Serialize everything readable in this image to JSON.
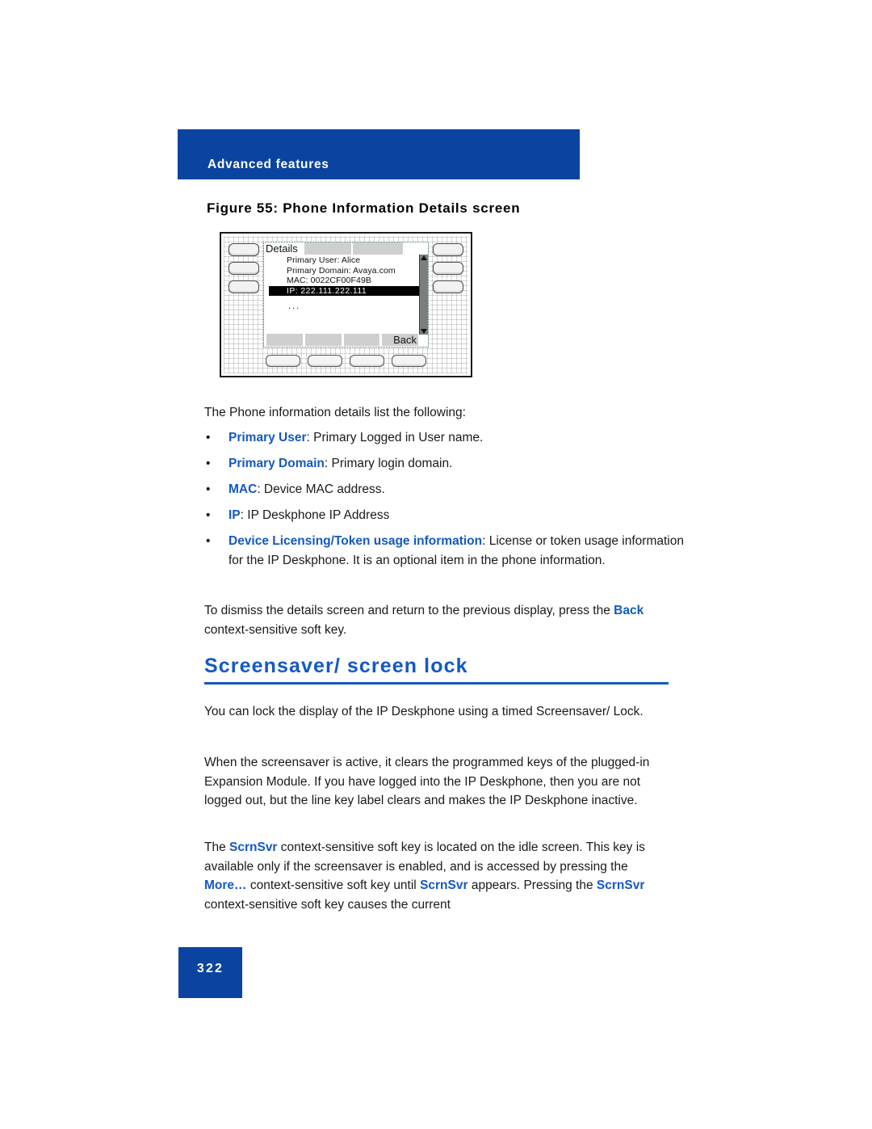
{
  "header": {
    "section_label": "Advanced features"
  },
  "figure": {
    "caption": "Figure 55: Phone Information Details screen",
    "device": {
      "screen_title": "Details",
      "lines": [
        "Primary User: Alice",
        "Primary Domain: Avaya.com",
        "MAC: 0022CF00F49B"
      ],
      "selected_line": "IP:  222.111.222.111",
      "more_indicator": "...",
      "soft_key_labels": [
        "",
        "",
        "",
        "Back"
      ],
      "scroll_up_icon": "scroll-up-arrow",
      "scroll_down_icon": "scroll-down-arrow"
    }
  },
  "content": {
    "lead_in": "The Phone information details list the following:",
    "bullets": [
      {
        "marker": "•",
        "term": "Primary User",
        "text": ": Primary Logged in User name."
      },
      {
        "marker": "•",
        "term": "Primary Domain",
        "text": ": Primary login domain."
      },
      {
        "marker": "•",
        "term": "MAC",
        "text": ": Device MAC address."
      },
      {
        "marker": "•",
        "term": "IP",
        "text": ": IP Deskphone IP Address"
      }
    ],
    "licensing_bullet": {
      "marker": "•",
      "term_part1": "Device Licensing",
      "term_separator": "/",
      "term_part2": "Token usage information",
      "text": ": License or token usage information for the IP Deskphone. It is an optional item in the phone information."
    },
    "dismiss_paragraph": {
      "lead": "To dismiss the details screen and return to the previous display, press the ",
      "key": "Back",
      "tail": " context-sensitive soft key."
    },
    "section_heading": "Screensaver/ screen lock",
    "lock_paragraph": "You can lock the display of the IP Deskphone using a timed Screensaver/ Lock.",
    "screensaver_paragraph": "When the screensaver is active, it clears the programmed keys of the plugged-in Expansion Module. If you have logged into the IP Deskphone, then you are not logged out, but the line key label clears and makes the IP Deskphone inactive.",
    "scrnsvr_paragraph": {
      "p1": "The ",
      "key1": "ScrnSvr",
      "p2": " context-sensitive soft key is located on the idle screen. This key is available only if the screensaver is enabled, and is accessed by pressing the ",
      "key2": "More…",
      "p3": " context-sensitive soft key until ",
      "key3": "ScrnSvr",
      "p4": " appears. Pressing the ",
      "key4": "ScrnSvr",
      "p5": " context-sensitive soft key causes the current"
    }
  },
  "footer": {
    "page_number": "322"
  },
  "colors": {
    "brand_blue": "#0B44A0",
    "accent_blue": "#1359C2"
  }
}
